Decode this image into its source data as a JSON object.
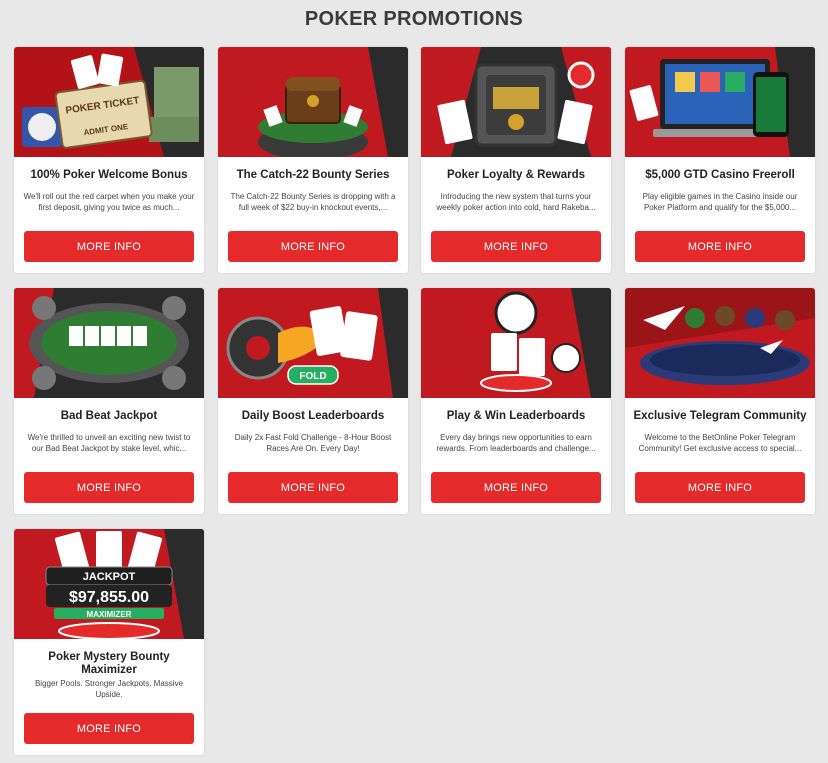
{
  "page": {
    "title": "POKER PROMOTIONS"
  },
  "colors": {
    "accent": "#e42a2a",
    "background": "#e8e8e8",
    "card": "#ffffff"
  },
  "promotions": [
    {
      "title": "100% Poker Welcome Bonus",
      "description": "We'll roll out the red carpet when you make your first deposit, giving you twice as much...",
      "image_ticket_text": "POKER TICKET",
      "image_ticket_sub": "ADMIT ONE",
      "button": "MORE INFO"
    },
    {
      "title": "The Catch-22 Bounty Series",
      "description": "The Catch-22 Bounty Series is dropping with a full week of $22 buy-in knockout events,...",
      "button": "MORE INFO"
    },
    {
      "title": "Poker Loyalty & Rewards",
      "description": "Introducing the new system that turns your weekly poker action into cold, hard Rakeba...",
      "button": "MORE INFO"
    },
    {
      "title": "$5,000 GTD Casino Freeroll",
      "description": "Play eligible games in the Casino inside our Poker Platform and qualify for the $5,000...",
      "button": "MORE INFO"
    },
    {
      "title": "Bad Beat Jackpot",
      "description": "We're thrilled to unveil an exciting new twist to our Bad Beat Jackpot by stake level, whic...",
      "button": "MORE INFO"
    },
    {
      "title": "Daily Boost Leaderboards",
      "description": "Daily 2x Fast Fold Challenge - 8-Hour Boost Races Are On. Every Day!",
      "image_badge": "FOLD",
      "button": "MORE INFO"
    },
    {
      "title": "Play & Win Leaderboards",
      "description": "Every day brings new opportunities to earn rewards. From leaderboards and challenge...",
      "button": "MORE INFO"
    },
    {
      "title": "Exclusive Telegram Community",
      "description": "Welcome to the BetOnline Poker Telegram Community! Get exclusive access to special...",
      "button": "MORE INFO"
    },
    {
      "title": "Poker Mystery Bounty Maximizer",
      "description": "Bigger Pools. Stronger Jackpots. Massive Upside.",
      "image_jackpot_label": "JACKPOT",
      "image_jackpot_amount": "$97,855.00",
      "image_jackpot_sub": "MAXIMIZER",
      "button": "MORE INFO"
    }
  ]
}
